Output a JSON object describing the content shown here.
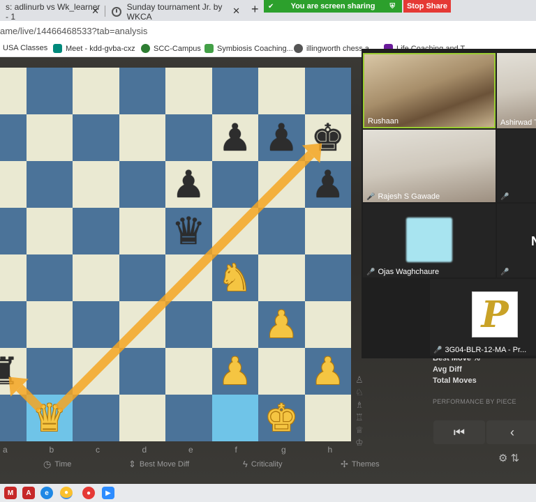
{
  "browser": {
    "tabs": [
      {
        "label": "s: adlinurb vs Wk_learner - 1",
        "close": "✕"
      },
      {
        "label": "Sunday tournament Jr. by WKCA",
        "close": "✕"
      }
    ],
    "new_tab": "+",
    "url": "ame/live/14466468533?tab=analysis",
    "bookmarks": [
      {
        "label": "USA Classes",
        "color": "#c62828"
      },
      {
        "label": "Meet - kdd-gvba-cxz",
        "color": "#00897b"
      },
      {
        "label": "SCC-Campus",
        "color": "#2e7d32"
      },
      {
        "label": "Symbiosis Coaching...",
        "color": "#43a047"
      },
      {
        "label": "illingworth chess a...",
        "color": "#555555"
      },
      {
        "label": "Life Coaching and T...",
        "color": "#6a1b9a"
      }
    ]
  },
  "screen_share": {
    "message": "You are screen sharing",
    "stop_label": "Stop Share"
  },
  "board": {
    "files": [
      "a",
      "b",
      "c",
      "d",
      "e",
      "f",
      "g",
      "h"
    ],
    "squares": [
      [
        "",
        "",
        "",
        "",
        "",
        "",
        "",
        ""
      ],
      [
        "",
        "",
        "",
        "",
        "",
        "bp",
        "bp",
        "bk"
      ],
      [
        "",
        "",
        "",
        "",
        "bp",
        "",
        "",
        "bp"
      ],
      [
        "",
        "",
        "",
        "",
        "bq",
        "",
        "",
        ""
      ],
      [
        "",
        "",
        "",
        "",
        "",
        "wn",
        "",
        ""
      ],
      [
        "",
        "",
        "",
        "",
        "",
        "",
        "wp",
        ""
      ],
      [
        "br",
        "",
        "",
        "",
        "",
        "wp",
        "",
        "wp"
      ],
      [
        "",
        "wq",
        "",
        "",
        "",
        "",
        "wk",
        ""
      ]
    ],
    "highlights": [
      "b1",
      "f1"
    ],
    "arrows": [
      {
        "from": "b1",
        "to": "h7"
      },
      {
        "from": "b1",
        "to": "a2"
      }
    ],
    "arrow_color": "#f5a623"
  },
  "board_tools": {
    "time": "Time",
    "best_move_diff": "Best Move Diff",
    "criticality": "Criticality",
    "themes": "Themes"
  },
  "stats_panel": {
    "rows": [
      "Best Move %",
      "Avg Diff",
      "Total Moves"
    ],
    "performance_title": "PERFORMANCE BY PIECE",
    "nav_first": "⏮",
    "nav_prev": "‹"
  },
  "zoom": {
    "participants": [
      {
        "name": "Rushaan",
        "muted": false,
        "active": true
      },
      {
        "name": "Ashirwad Ti",
        "muted": false,
        "active": false
      },
      {
        "name": "Rajesh S Gawade",
        "muted": true,
        "active": false
      },
      {
        "name": "Ojas Waghchaure",
        "muted": true,
        "active": false
      },
      {
        "name": "3G04-BLR-12-MA - Pr...",
        "muted": true,
        "active": false
      }
    ],
    "partial_letter": "N",
    "logo_letter": "P"
  }
}
